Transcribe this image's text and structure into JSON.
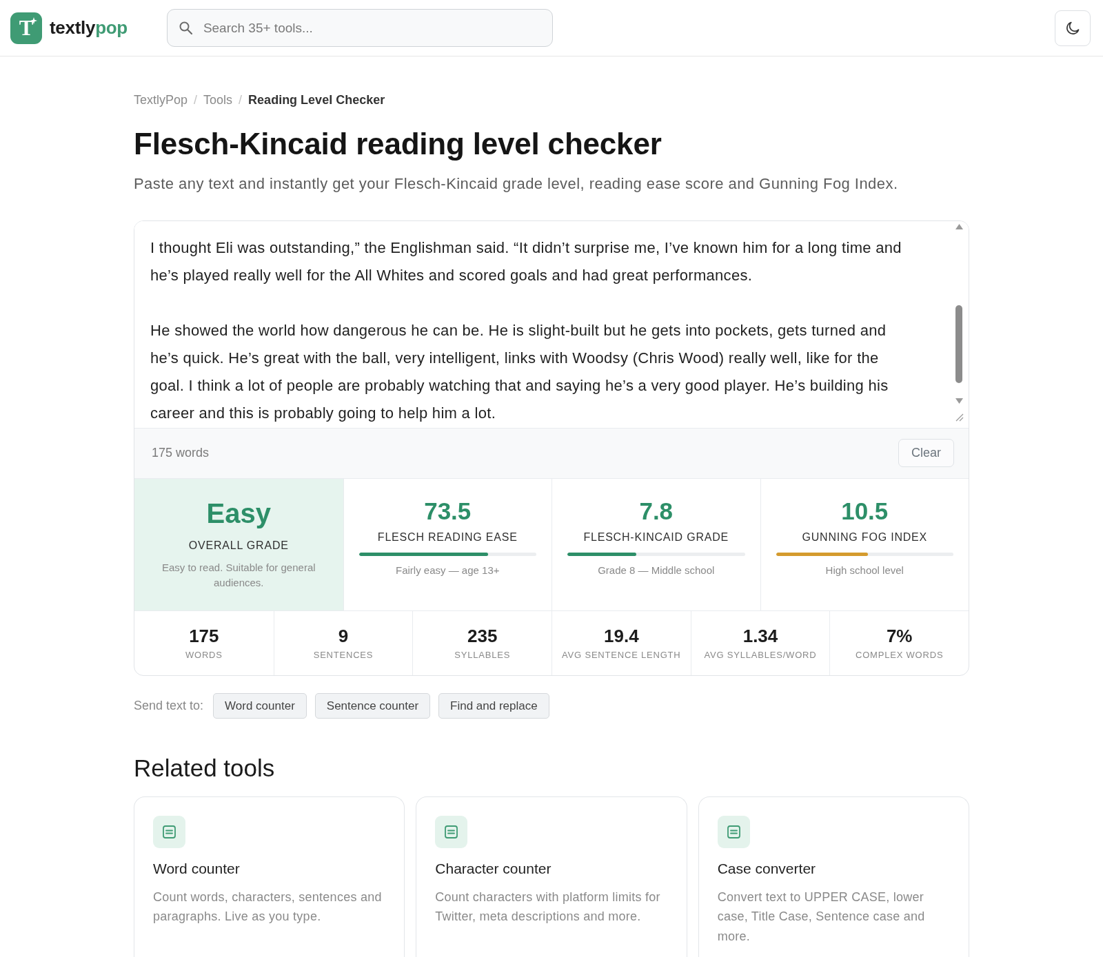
{
  "header": {
    "logo": {
      "mark": "T",
      "name": "textly",
      "name_accent": "pop"
    },
    "search": {
      "placeholder": "Search 35+ tools..."
    }
  },
  "breadcrumb": {
    "items": [
      {
        "label": "TextlyPop",
        "current": false
      },
      {
        "separator": "/",
        "label": "Tools",
        "current": false
      },
      {
        "separator": "/",
        "label": "Reading Level Checker",
        "current": true
      }
    ]
  },
  "title": "Flesch-Kincaid reading level checker",
  "subtitle": "Paste any text and instantly get your Flesch-Kincaid grade level, reading ease score and Gunning Fog Index.",
  "editor": {
    "value": "I thought Eli was outstanding,” the Englishman said. “It didn’t surprise me, I’ve known him for a long time and he’s played really well for the All Whites and scored goals and had great performances.\n\nHe showed the world how dangerous he can be. He is slight-built but he gets into pockets, gets turned and he’s quick. He’s great with the ball, very intelligent, links with Woodsy (Chris Wood) really well, like for the goal. I think a lot of people are probably watching that and saying he’s a very good player. He’s building his career and this is probably going to help him a lot.",
    "word_count": "175 words",
    "clear_button": "Clear"
  },
  "overall": {
    "value": "Easy",
    "label": "OVERALL GRADE",
    "description": "Easy to read. Suitable for general audiences."
  },
  "metrics": [
    {
      "value": "73.5",
      "label": "FLESCH READING EASE",
      "level": 0.73,
      "color": "#2d8f68",
      "note": "Fairly easy — age 13+"
    },
    {
      "value": "7.8",
      "label": "FLESCH-KINCAID GRADE",
      "level": 0.39,
      "color": "#2d8f68",
      "note": "Grade 8 — Middle school"
    },
    {
      "value": "10.5",
      "label": "GUNNING FOG INDEX",
      "level": 0.52,
      "color": "#d49b2e",
      "note": "High school level"
    }
  ],
  "stats": [
    {
      "value": "175",
      "label": "WORDS"
    },
    {
      "value": "9",
      "label": "SENTENCES"
    },
    {
      "value": "235",
      "label": "SYLLABLES"
    },
    {
      "value": "19.4",
      "label": "AVG SENTENCE LENGTH"
    },
    {
      "value": "1.34",
      "label": "AVG SYLLABLES/WORD"
    },
    {
      "value": "7%",
      "label": "COMPLEX WORDS"
    }
  ],
  "send_to": {
    "label": "Send text to:",
    "buttons": [
      "Word counter",
      "Sentence counter",
      "Find and replace"
    ]
  },
  "related": {
    "heading": "Related tools",
    "cards": [
      {
        "title": "Word counter",
        "description": "Count words, characters, sentences and paragraphs. Live as you type."
      },
      {
        "title": "Character counter",
        "description": "Count characters with platform limits for Twitter, meta descriptions and more."
      },
      {
        "title": "Case converter",
        "description": "Convert text to UPPER CASE, lower case, Title Case, Sentence case and more."
      }
    ]
  }
}
